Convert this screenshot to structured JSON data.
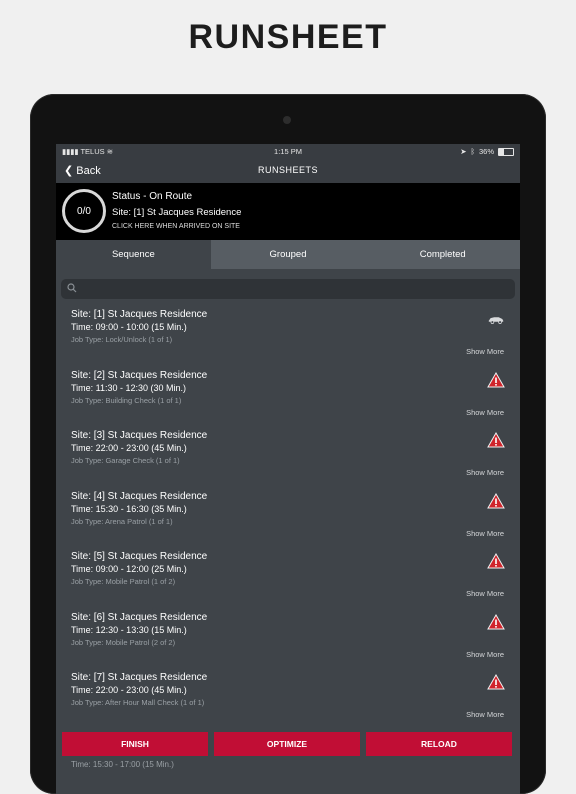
{
  "heading": "RUNSHEET",
  "statusbar": {
    "carrier": "TELUS",
    "time": "1:15 PM",
    "battery": "36%",
    "battery_level": 0.36
  },
  "navbar": {
    "back": "Back",
    "title": "RUNSHEETS"
  },
  "status": {
    "counter": "0/0",
    "status_text": "Status - On Route",
    "site_text": "Site: [1] St Jacques Residence",
    "hint": "CLICK HERE WHEN ARRIVED ON SITE"
  },
  "tabs": [
    {
      "label": "Sequence",
      "active": true
    },
    {
      "label": "Grouped",
      "active": false
    },
    {
      "label": "Completed",
      "active": false
    }
  ],
  "search": {
    "placeholder": ""
  },
  "jobs": [
    {
      "site": "Site: [1] St Jacques Residence",
      "time": "Time: 09:00 - 10:00 (15 Min.)",
      "job": "Job Type: Lock/Unlock (1 of 1)",
      "more": "Show More",
      "icon": "car-icon"
    },
    {
      "site": "Site: [2] St Jacques Residence",
      "time": "Time: 11:30 - 12:30 (30 Min.)",
      "job": "Job Type: Building Check (1 of 1)",
      "more": "Show More",
      "icon": "warning-icon"
    },
    {
      "site": "Site: [3] St Jacques Residence",
      "time": "Time: 22:00 - 23:00 (45 Min.)",
      "job": "Job Type: Garage Check (1 of 1)",
      "more": "Show More",
      "icon": "warning-icon"
    },
    {
      "site": "Site: [4] St Jacques Residence",
      "time": "Time: 15:30 - 16:30 (35 Min.)",
      "job": "Job Type: Arena Patrol (1 of 1)",
      "more": "Show More",
      "icon": "warning-icon"
    },
    {
      "site": "Site: [5] St Jacques Residence",
      "time": "Time: 09:00 - 12:00 (25 Min.)",
      "job": "Job Type: Mobile Patrol (1 of 2)",
      "more": "Show More",
      "icon": "warning-icon"
    },
    {
      "site": "Site: [6] St Jacques Residence",
      "time": "Time: 12:30 - 13:30 (15 Min.)",
      "job": "Job Type: Mobile Patrol (2 of 2)",
      "more": "Show More",
      "icon": "warning-icon"
    },
    {
      "site": "Site: [7] St Jacques Residence",
      "time": "Time: 22:00 - 23:00 (45 Min.)",
      "job": "Job Type: After Hour Mall Check (1 of 1)",
      "more": "Show More",
      "icon": "warning-icon"
    }
  ],
  "actions": {
    "finish": "FINISH",
    "optimize": "OPTIMIZE",
    "reload": "RELOAD"
  },
  "peek_text": "Time: 15:30 - 17:00 (15 Min.)",
  "colors": {
    "accent": "#c10e35",
    "background": "#3f4449",
    "warning": "#d0242b"
  }
}
